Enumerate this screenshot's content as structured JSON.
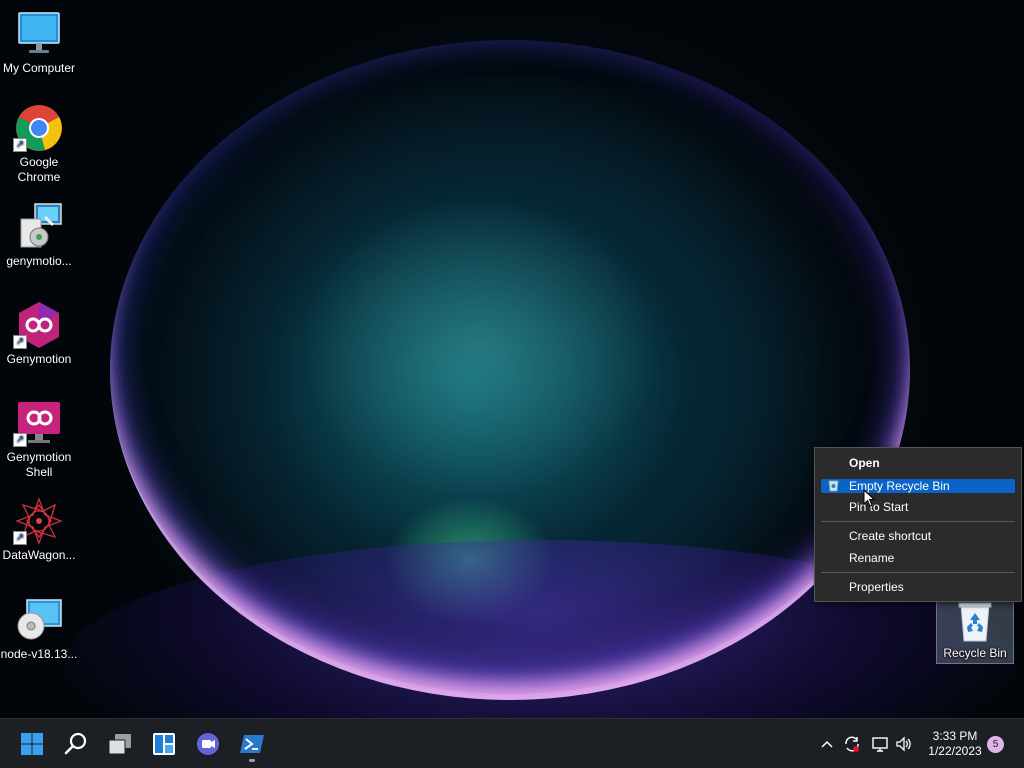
{
  "desktop": {
    "icons": [
      {
        "label": "My Computer"
      },
      {
        "label": "Google Chrome"
      },
      {
        "label": "genymotio..."
      },
      {
        "label": "Genymotion"
      },
      {
        "label": "Genymotion Shell"
      },
      {
        "label": "DataWagon..."
      },
      {
        "label": "node-v18.13..."
      },
      {
        "label": "Recycle Bin"
      }
    ]
  },
  "context_menu": {
    "items": [
      {
        "label": "Open"
      },
      {
        "label": "Empty Recycle Bin"
      },
      {
        "label": "Pin to Start"
      },
      {
        "label": "Create shortcut"
      },
      {
        "label": "Rename"
      },
      {
        "label": "Properties"
      }
    ]
  },
  "taskbar": {
    "clock_time": "3:33 PM",
    "clock_date": "1/22/2023",
    "notification_count": "5"
  },
  "colors": {
    "menu_highlight": "#0a64c8",
    "taskbar_bg": "#1c1f24",
    "menu_bg": "#2b2b2b"
  }
}
